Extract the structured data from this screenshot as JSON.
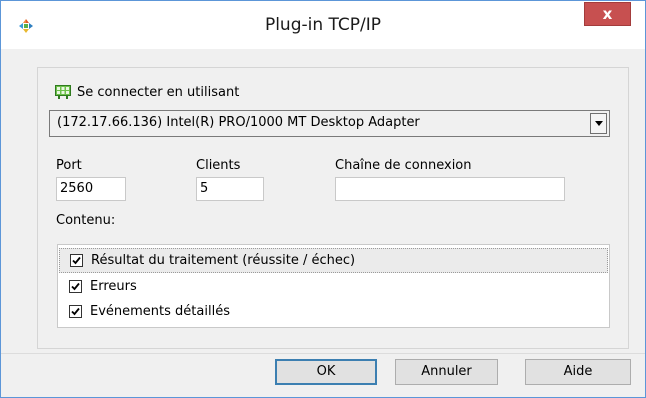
{
  "window": {
    "title": "Plug-in TCP/IP",
    "close_label": "x"
  },
  "connection": {
    "label": "Se connecter en utilisant",
    "adapter": "(172.17.66.136) Intel(R) PRO/1000 MT Desktop Adapter"
  },
  "fields": {
    "port_label": "Port",
    "port_value": "2560",
    "clients_label": "Clients",
    "clients_value": "5",
    "connection_string_label": "Chaîne de connexion",
    "connection_string_value": ""
  },
  "content": {
    "label": "Contenu:",
    "items": [
      {
        "label": "Résultat du traitement (réussite / échec)",
        "checked": true
      },
      {
        "label": "Erreurs",
        "checked": true
      },
      {
        "label": "Evénements détaillés",
        "checked": true
      }
    ]
  },
  "buttons": {
    "ok": "OK",
    "cancel": "Annuler",
    "help": "Aide"
  }
}
